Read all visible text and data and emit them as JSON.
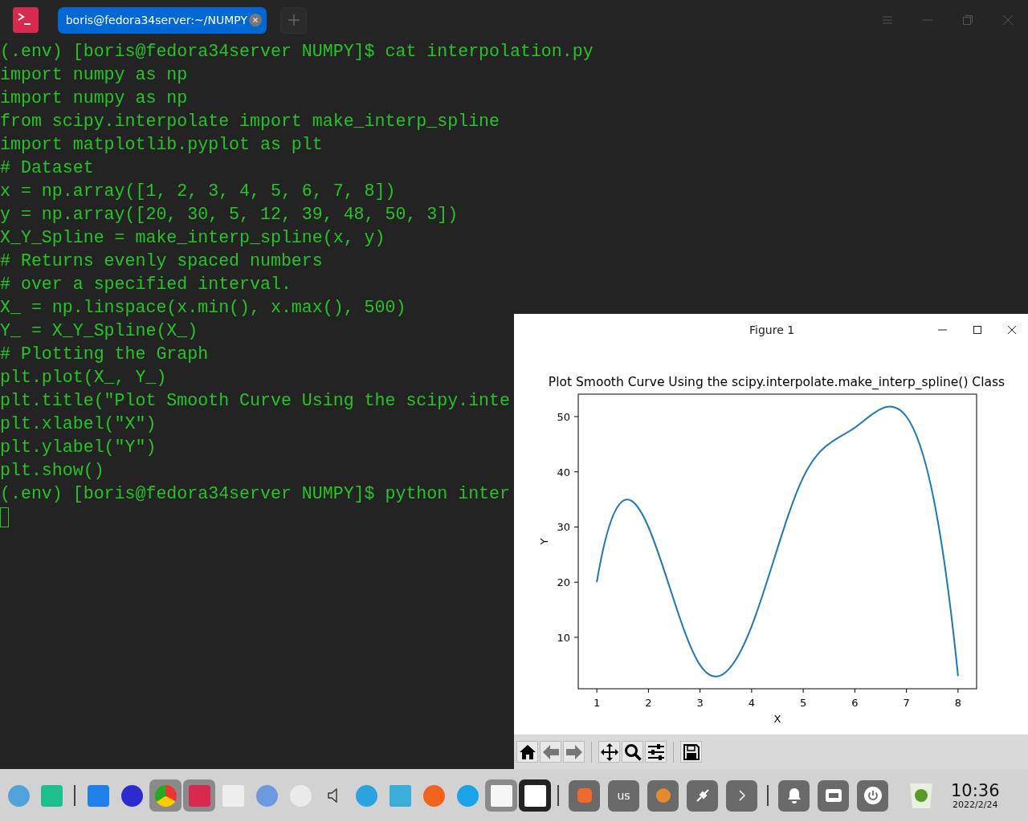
{
  "terminal": {
    "tab_title": "boris@fedora34server:~/NUMPY",
    "lines": [
      "(.env) [boris@fedora34server NUMPY]$ cat interpolation.py",
      "import numpy as np",
      "import numpy as np",
      "from scipy.interpolate import make_interp_spline",
      "import matplotlib.pyplot as plt",
      "# Dataset",
      "x = np.array([1, 2, 3, 4, 5, 6, 7, 8])",
      "y = np.array([20, 30, 5, 12, 39, 48, 50, 3])",
      "X_Y_Spline = make_interp_spline(x, y)",
      "# Returns evenly spaced numbers",
      "# over a specified interval.",
      "X_ = np.linspace(x.min(), x.max(), 500)",
      "Y_ = X_Y_Spline(X_)",
      "# Plotting the Graph",
      "plt.plot(X_, Y_)",
      "plt.title(\"Plot Smooth Curve Using the scipy.inte",
      "plt.xlabel(\"X\")",
      "plt.ylabel(\"Y\")",
      "plt.show()",
      "(.env) [boris@fedora34server NUMPY]$ python inter"
    ]
  },
  "figure": {
    "title": "Figure 1",
    "chart_data": {
      "type": "line",
      "title": "Plot Smooth Curve Using the scipy.interpolate.make_interp_spline() Class",
      "xlabel": "X",
      "ylabel": "Y",
      "x": [
        1,
        2,
        3,
        4,
        5,
        6,
        7,
        8
      ],
      "series": [
        {
          "color": "#1f77b4",
          "values": [
            20,
            30,
            5,
            12,
            39,
            48,
            50,
            3
          ]
        }
      ],
      "xlim": [
        0.64,
        8.36
      ],
      "ylim": [
        0.69,
        54.07
      ],
      "xticks": [
        1,
        2,
        3,
        4,
        5,
        6,
        7,
        8
      ],
      "yticks": [
        10,
        20,
        30,
        40,
        50
      ]
    }
  },
  "taskbar": {
    "keyboard_layout": "us",
    "time": "10:36",
    "date": "2022/2/24"
  }
}
